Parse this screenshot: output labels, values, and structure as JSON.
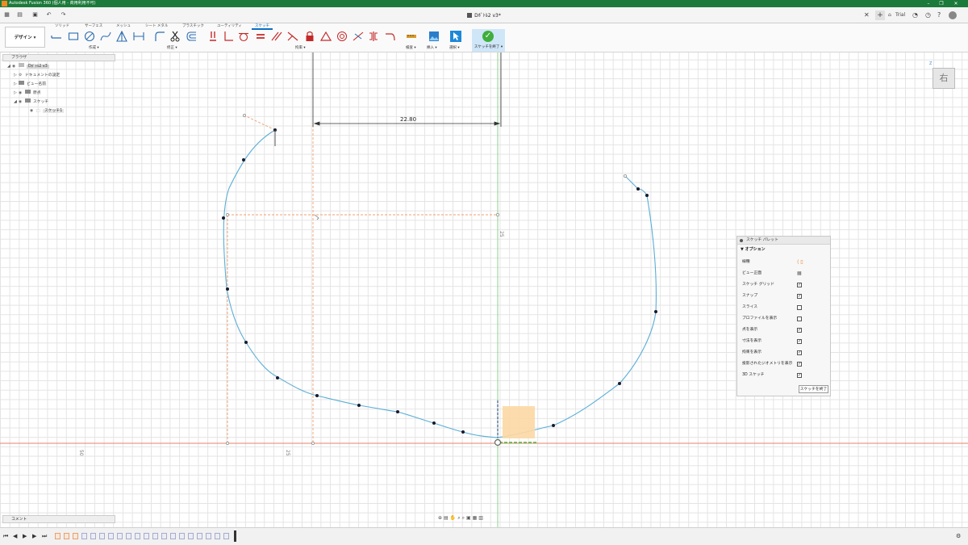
{
  "window": {
    "title": "Autodesk Fusion 360 (個人用 - 商用利用不可)"
  },
  "document": {
    "tab_title": "Dﾎﾞﾄﾙ2 v3*"
  },
  "tabbar": {
    "trial": "Trial"
  },
  "ribbon": {
    "workspace": "デザイン ▾",
    "tabs": [
      "ソリッド",
      "サーフェス",
      "メッシュ",
      "シート メタル",
      "プラスチック",
      "ユーティリティ",
      "スケッチ"
    ],
    "active_tab": "スケッチ",
    "groups": {
      "create": "作成 ▾",
      "modify": "修正 ▾",
      "constraints": "拘束 ▾",
      "inspect": "検査 ▾",
      "insert": "挿入 ▾",
      "select": "選択 ▾"
    },
    "finish_sketch": "スケッチを終了 ▾"
  },
  "browser": {
    "title": "ブラウザ",
    "items": [
      {
        "label": "Dﾎﾞﾄﾙ2 v3"
      },
      {
        "label": "ドキュメントの設定"
      },
      {
        "label": "ビュー名前"
      },
      {
        "label": "原点"
      },
      {
        "label": "スケッチ"
      },
      {
        "label": "スケッチ1"
      }
    ]
  },
  "comments": {
    "title": "コメント"
  },
  "viewcube": {
    "face": "右",
    "axis": "Z"
  },
  "canvas": {
    "dimension": "22.80",
    "axis_labels": [
      "50",
      "25",
      "25"
    ]
  },
  "palette": {
    "title": "スケッチ パレット",
    "section": "▼ オプション",
    "rows": [
      {
        "label": "線種",
        "type": "icon"
      },
      {
        "label": "ビュー正面",
        "type": "icon"
      },
      {
        "label": "スケッチ グリッド",
        "checked": true
      },
      {
        "label": "スナップ",
        "checked": true
      },
      {
        "label": "スライス",
        "checked": false
      },
      {
        "label": "プロファイルを表示",
        "checked": false
      },
      {
        "label": "点を表示",
        "checked": true
      },
      {
        "label": "寸法を表示",
        "checked": true
      },
      {
        "label": "拘束を表示",
        "checked": true
      },
      {
        "label": "投影されたジオメトリを表示",
        "checked": true
      },
      {
        "label": "3D スケッチ",
        "checked": true
      }
    ],
    "finish_button": "スケッチを終了"
  },
  "colors": {
    "title_green": "#1c7a3a",
    "accent_blue": "#0b6fc4",
    "curve_blue": "#5aaed6",
    "construction_orange": "#f0a070",
    "axis_red": "#e8826a",
    "axis_green": "#8fd08f"
  }
}
